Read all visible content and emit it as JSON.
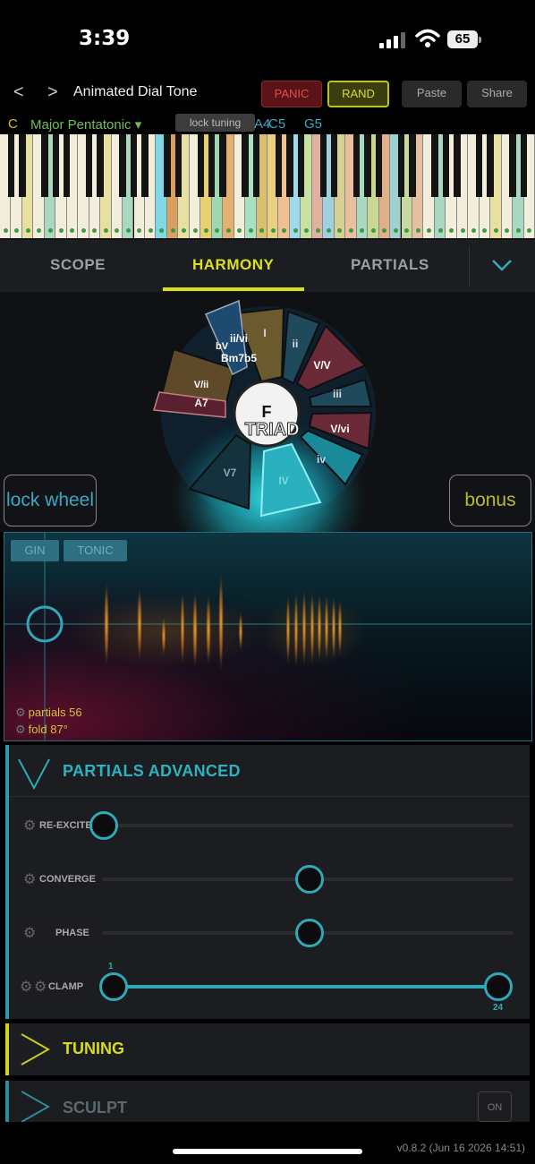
{
  "status": {
    "time": "3:39",
    "battery": "65"
  },
  "topbar": {
    "back": "<",
    "forward": ">",
    "title": "Animated Dial Tone",
    "panic": "PANIC",
    "rand": "RAND",
    "paste": "Paste",
    "share": "Share"
  },
  "scale": {
    "key": "C",
    "name": "Major Pentatonic ▾",
    "lock_tuning": "lock tuning",
    "notes": [
      "A4",
      "C5",
      "G5"
    ]
  },
  "tabs": {
    "scope": "SCOPE",
    "harmony": "HARMONY",
    "partials": "PARTIALS"
  },
  "wheel": {
    "center_note": "F",
    "center_type": "TRIAD",
    "segments": [
      "I",
      "ii",
      "V/V",
      "iii",
      "V/vi",
      "iv",
      "IV",
      "V7",
      "V/ii",
      "bV",
      "ii/vi"
    ],
    "chord_labels": {
      "bm7b5": "Bm7b5",
      "a7": "A7"
    }
  },
  "side_buttons": {
    "lock_wheel": "lock wheel",
    "bonus": "bonus"
  },
  "scope": {
    "chip_gin": "GIN",
    "chip_tonic": "TONIC",
    "partials": "partials 56",
    "fold": "fold 87°"
  },
  "partials_advanced": {
    "title": "PARTIALS ADVANCED",
    "rows": [
      {
        "label": "RE-EXCITE",
        "value": 0.0
      },
      {
        "label": "CONVERGE",
        "value": 0.5
      },
      {
        "label": "PHASE",
        "value": 0.5
      },
      {
        "label": "CLAMP",
        "min": "1",
        "max": "24"
      }
    ]
  },
  "tuning": {
    "title": "TUNING"
  },
  "sculpt": {
    "title": "SCULPT",
    "on": "ON"
  },
  "footer": {
    "version": "v0.8.2 (Jun 16 2026 14:51)"
  },
  "colors": {
    "accent_teal": "#2fa8b8",
    "accent_yellow": "#d9e020",
    "panic_red": "#e05050"
  }
}
